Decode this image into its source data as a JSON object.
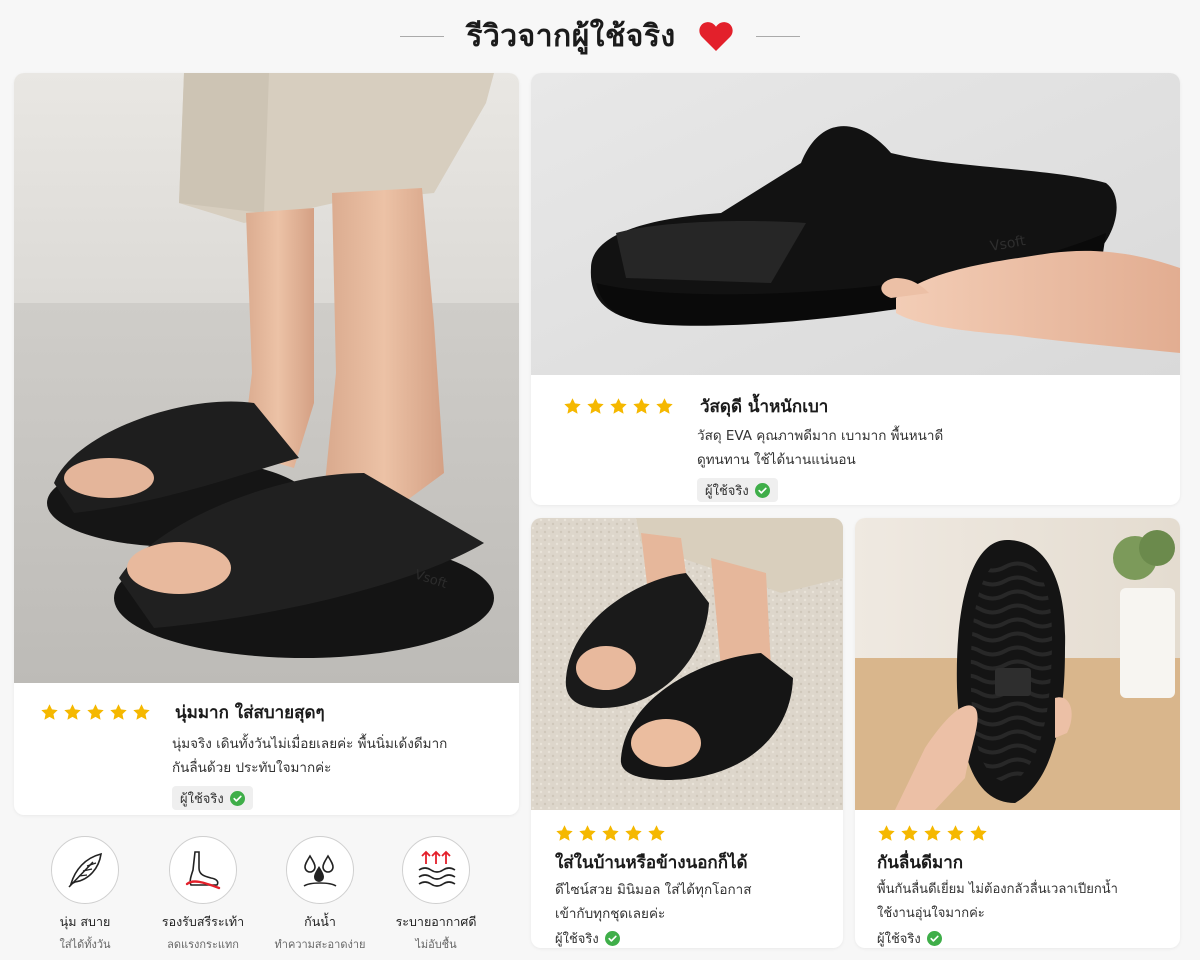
{
  "header": {
    "title": "รีวิวจากผู้ใช้จริง"
  },
  "badge_label": "ผู้ใช้จริง",
  "colors": {
    "star": "#f5b800",
    "check": "#3fae49",
    "heart": "#e3202b"
  },
  "reviews": [
    {
      "rating": 5,
      "title": "นุ่มมาก ใส่สบายสุดๆ",
      "lines": [
        "นุ่มจริง เดินทั้งวันไม่เมื่อยเลยค่ะ พื้นนิ่มเด้งดีมาก",
        "กันลื่นด้วย ประทับใจมากค่ะ"
      ]
    },
    {
      "rating": 5,
      "title": "วัสดุดี น้ำหนักเบา",
      "lines": [
        "วัสดุ EVA คุณภาพดีมาก เบามาก พื้นหนาดี",
        "ดูทนทาน ใช้ได้นานแน่นอน"
      ]
    },
    {
      "rating": 5,
      "title": "ใส่ในบ้านหรือข้างนอกก็ได้",
      "lines": [
        "ดีไซน์สวย มินิมอล ใส่ได้ทุกโอกาส",
        "เข้ากับทุกชุดเลยค่ะ"
      ]
    },
    {
      "rating": 5,
      "title": "กันลื่นดีมาก",
      "lines": [
        "พื้นกันลื่นดีเยี่ยม ไม่ต้องกลัวลื่นเวลาเปียกน้ำ",
        "ใช้งานอุ่นใจมากค่ะ"
      ]
    }
  ],
  "features": [
    {
      "icon": "feather-icon",
      "label": "นุ่ม สบาย",
      "sub": "ใส่ได้ทั้งวัน"
    },
    {
      "icon": "foot-arch-icon",
      "label": "รองรับสรีระเท้า",
      "sub": "ลดแรงกระแทก"
    },
    {
      "icon": "water-drops-icon",
      "label": "กันน้ำ",
      "sub": "ทำความสะอาดง่าย"
    },
    {
      "icon": "ventilation-icon",
      "label": "ระบายอากาศดี",
      "sub": "ไม่อับชื้น"
    }
  ],
  "brand_mark": "Vsoft"
}
